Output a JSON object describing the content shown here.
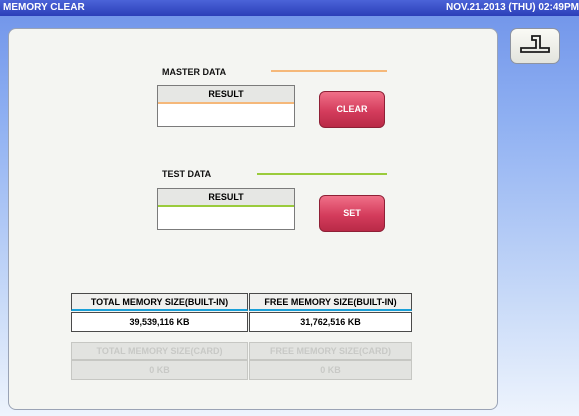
{
  "window": {
    "title": "MEMORY CLEAR",
    "datetime": "NOV.21.2013 (THU) 02:49PM"
  },
  "colors": {
    "title_bar": "#2b3fb8",
    "master_accent": "#f5b87a",
    "test_accent": "#9acb3c",
    "built_in_accent": "#1aa0d8",
    "button_red": "#d43c5c"
  },
  "back_button": {
    "icon": "return-arrow-icon"
  },
  "master": {
    "label": "MASTER DATA",
    "result_header": "RESULT",
    "result_value": "",
    "button_label": "CLEAR"
  },
  "test": {
    "label": "TEST DATA",
    "result_header": "RESULT",
    "result_value": "",
    "button_label": "SET"
  },
  "memory": {
    "builtin_total_label": "TOTAL MEMORY SIZE(BUILT-IN)",
    "builtin_total_value": "39,539,116 KB",
    "builtin_free_label": "FREE MEMORY SIZE(BUILT-IN)",
    "builtin_free_value": "31,762,516 KB",
    "card_total_label": "TOTAL MEMORY SIZE(CARD)",
    "card_total_value": "0 KB",
    "card_free_label": "FREE MEMORY SIZE(CARD)",
    "card_free_value": "0 KB"
  }
}
